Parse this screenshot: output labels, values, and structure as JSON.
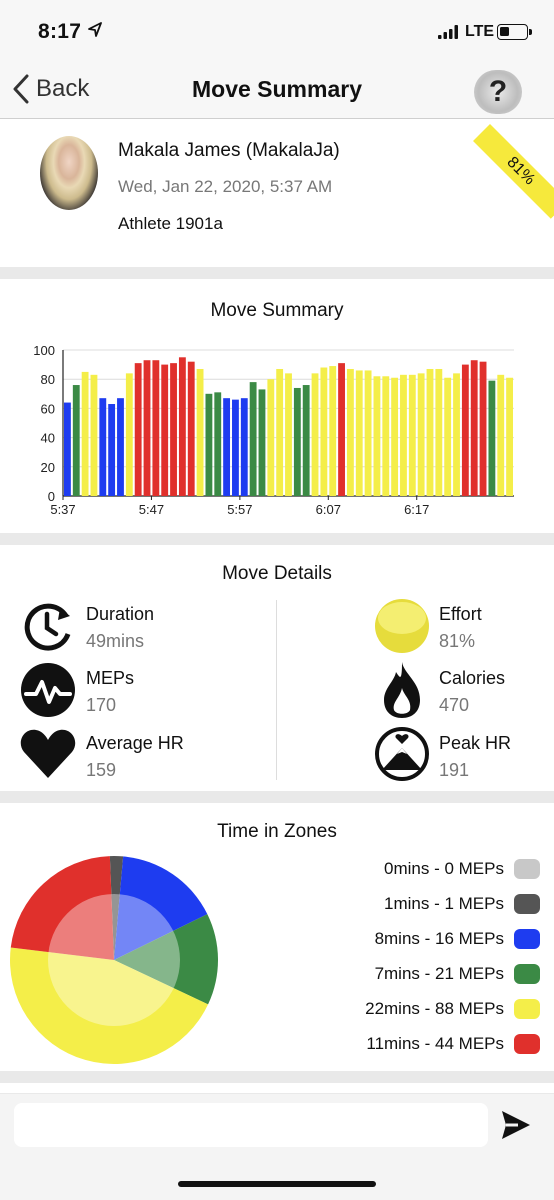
{
  "status_bar": {
    "time": "8:17",
    "carrier": "LTE",
    "location_icon": "location-arrow-icon",
    "signal_icon": "signal-bars-icon",
    "battery_icon": "battery-icon"
  },
  "nav": {
    "back_label": "Back",
    "title": "Move Summary",
    "help_label": "?"
  },
  "profile": {
    "name": "Makala James (MakalaJa)",
    "date": "Wed, Jan 22, 2020, 5:37 AM",
    "athlete": "Athlete 1901a",
    "effort_badge": "81%",
    "badge_color": "#f6e93c"
  },
  "summary_title": "Move Summary",
  "chart_data": {
    "type": "bar",
    "title": "Move Summary",
    "xlabel": "",
    "ylabel": "",
    "ylim": [
      0,
      100
    ],
    "yticks": [
      0,
      20,
      40,
      60,
      80,
      100
    ],
    "xticks": [
      "5:37",
      "5:47",
      "5:57",
      "6:07",
      "6:17"
    ],
    "grid": true,
    "zone_colors": {
      "blue": "#1e3cf0",
      "green": "#3b8a45",
      "yellow": "#f4ee49",
      "red": "#e0302c"
    },
    "values": [
      64,
      76,
      85,
      83,
      67,
      63,
      67,
      84,
      91,
      93,
      93,
      90,
      91,
      95,
      92,
      87,
      70,
      71,
      67,
      66,
      67,
      78,
      73,
      80,
      87,
      84,
      74,
      76,
      84,
      88,
      89,
      91,
      87,
      86,
      86,
      82,
      82,
      81,
      83,
      83,
      84,
      87,
      87,
      81,
      84,
      90,
      93,
      92,
      79,
      83,
      81
    ],
    "colors": [
      "blue",
      "green",
      "yellow",
      "yellow",
      "blue",
      "blue",
      "blue",
      "yellow",
      "red",
      "red",
      "red",
      "red",
      "red",
      "red",
      "red",
      "yellow",
      "green",
      "green",
      "blue",
      "blue",
      "blue",
      "green",
      "green",
      "yellow",
      "yellow",
      "yellow",
      "green",
      "green",
      "yellow",
      "yellow",
      "yellow",
      "red",
      "yellow",
      "yellow",
      "yellow",
      "yellow",
      "yellow",
      "yellow",
      "yellow",
      "yellow",
      "yellow",
      "yellow",
      "yellow",
      "yellow",
      "yellow",
      "red",
      "red",
      "red",
      "green",
      "yellow",
      "yellow"
    ]
  },
  "details": {
    "title": "Move Details",
    "duration": {
      "label": "Duration",
      "value": "49mins",
      "icon": "stopwatch-icon"
    },
    "meps": {
      "label": "MEPs",
      "value": "170",
      "icon": "heartbeat-pulse-icon"
    },
    "avg_hr": {
      "label": "Average HR",
      "value": "159",
      "icon": "heart-icon"
    },
    "effort": {
      "label": "Effort",
      "value": "81%",
      "icon": "effort-circle-icon"
    },
    "calories": {
      "label": "Calories",
      "value": "470",
      "icon": "flame-icon"
    },
    "peak_hr": {
      "label": "Peak HR",
      "value": "191",
      "icon": "mountain-peak-icon"
    }
  },
  "zones": {
    "title": "Time in Zones",
    "legend": [
      {
        "label": "0mins - 0 MEPs",
        "color": "#c8c8c8"
      },
      {
        "label": "1mins - 1 MEPs",
        "color": "#555555"
      },
      {
        "label": "8mins - 16 MEPs",
        "color": "#1e3cf0"
      },
      {
        "label": "7mins - 21 MEPs",
        "color": "#3b8a45"
      },
      {
        "label": "22mins - 88 MEPs",
        "color": "#f4ee49"
      },
      {
        "label": "11mins - 44 MEPs",
        "color": "#e0302c"
      }
    ],
    "pie_minutes": [
      0,
      1,
      8,
      7,
      22,
      11
    ]
  },
  "composer": {
    "placeholder": "",
    "send_icon": "send-arrow-icon"
  }
}
